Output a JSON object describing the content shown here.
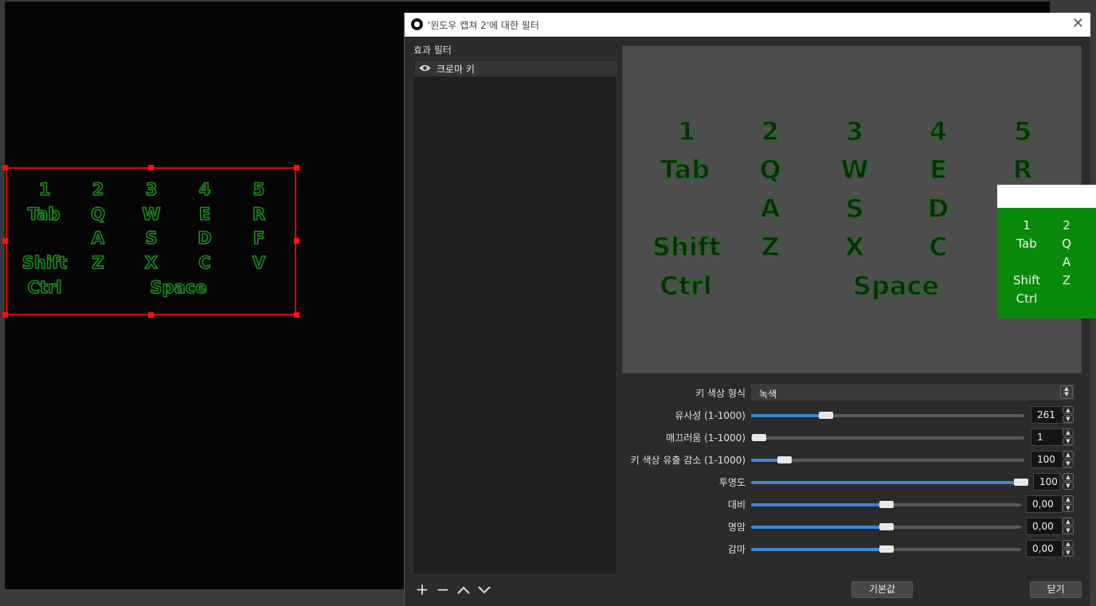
{
  "source_keyboard": {
    "keys": [
      "1",
      "2",
      "3",
      "4",
      "5",
      "Tab",
      "Q",
      "W",
      "E",
      "R",
      "A",
      "S",
      "D",
      "F",
      "Shift",
      "Z",
      "X",
      "C",
      "V",
      "Ctrl",
      "Space"
    ]
  },
  "dialog": {
    "title": "'윈도우 캡쳐 2'에 대한 필터",
    "close_glyph": "✕",
    "filters_label": "효과 필터",
    "filter_item": "크로마 키",
    "list_controls": {
      "add": "+",
      "remove": "−",
      "up": "⌃",
      "down": "⌄"
    },
    "preview_keys": [
      "1",
      "2",
      "3",
      "4",
      "5",
      "Tab",
      "Q",
      "W",
      "E",
      "R",
      "A",
      "S",
      "D",
      "Shift",
      "Z",
      "X",
      "C",
      "Ctrl",
      "Space"
    ],
    "green_panel_keys": [
      "1",
      "2",
      "Tab",
      "Q",
      "A",
      "Shift",
      "Z",
      "Ctrl"
    ],
    "properties": {
      "key_color_type": {
        "label": "키 색상 형식",
        "value": "녹색"
      },
      "similarity": {
        "label": "유사성 (1-1000)",
        "value": "261",
        "fraction": 0.261
      },
      "smoothness": {
        "label": "매끄러움 (1-1000)",
        "value": "1",
        "fraction": 0.0
      },
      "spill": {
        "label": "키 색상 유출 감소 (1-1000)",
        "value": "100",
        "fraction": 0.1
      },
      "opacity": {
        "label": "투명도",
        "value": "100",
        "fraction": 1.0
      },
      "contrast": {
        "label": "대비",
        "value": "0,00",
        "fraction": 0.5
      },
      "brightness": {
        "label": "명암",
        "value": "0,00",
        "fraction": 0.5
      },
      "gamma": {
        "label": "감마",
        "value": "0,00",
        "fraction": 0.5
      }
    },
    "defaults_button": "기본값",
    "close_button": "닫기"
  },
  "colors": {
    "accent": "#3d86d9",
    "selection": "#e00000",
    "chroma_green": "#0a8a0a"
  }
}
